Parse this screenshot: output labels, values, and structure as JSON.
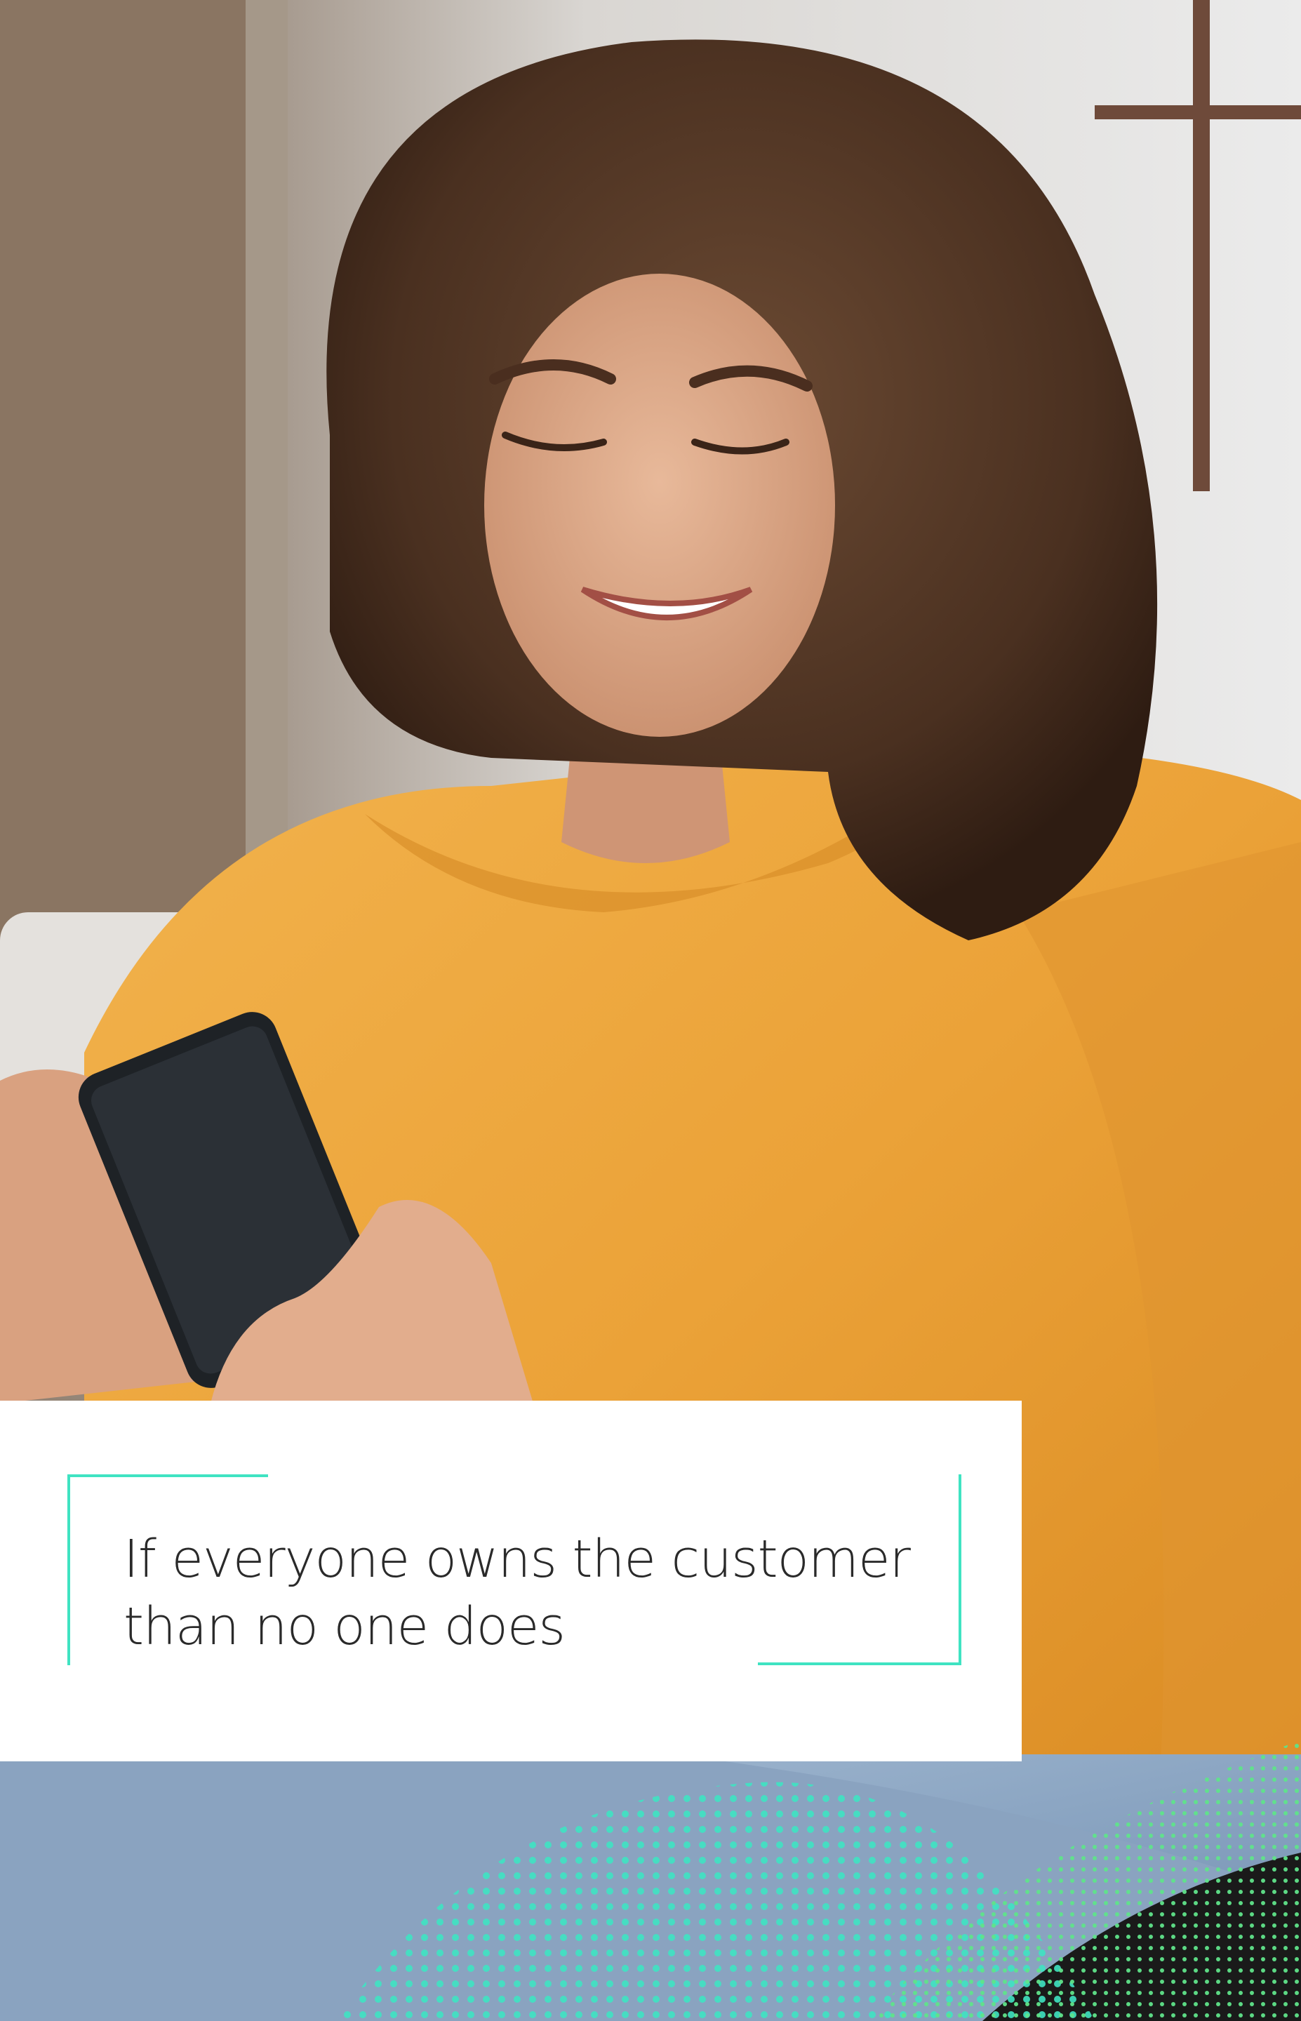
{
  "quote": {
    "line_1": "If everyone owns the customer",
    "line_2": "than no one does"
  },
  "colors": {
    "accent": "#3fe3c2",
    "accent_green": "#5fe38a",
    "hoodie": "#efa73e",
    "card_bg": "#ffffff",
    "text": "#2a2a2a"
  }
}
